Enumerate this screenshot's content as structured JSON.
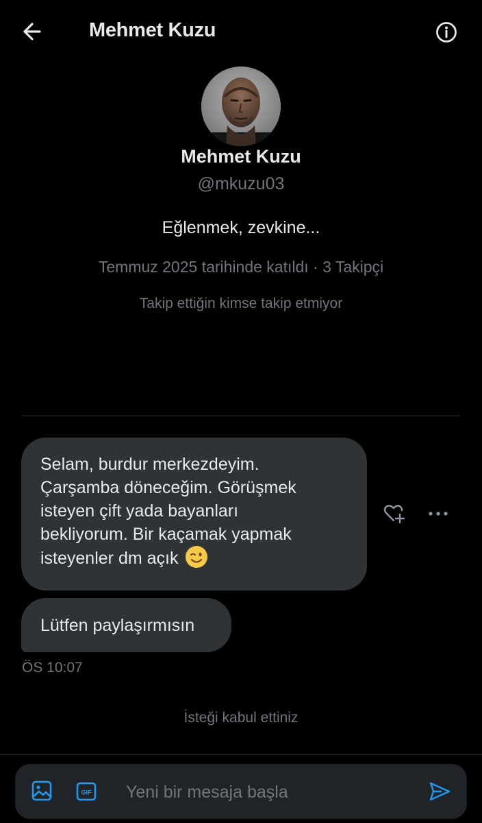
{
  "header": {
    "title": "Mehmet Kuzu"
  },
  "profile": {
    "name": "Mehmet Kuzu",
    "handle": "@mkuzu03",
    "bio": "Eğlenmek, zevkine...",
    "meta": "Temmuz 2025 tarihinde katıldı · 3 Takipçi",
    "follow_note": "Takip ettiğin kimse takip etmiyor"
  },
  "messages": [
    {
      "lines": [
        "Selam, burdur merkezdeyim.",
        "Çarşamba döneceğim. Görüşmek",
        "isteyen çift yada bayanları",
        "bekliyorum. Bir kaçamak yapmak",
        "isteyenler dm açık"
      ],
      "emoji": "winking-face"
    },
    {
      "text": "Lütfen paylaşırmısın"
    }
  ],
  "timestamp": "ÖS 10:07",
  "status_text": "İsteği kabul ettiniz",
  "composer": {
    "placeholder": "Yeni bir mesaja başla",
    "gif_label": "GIF"
  },
  "colors": {
    "background": "#000000",
    "bubble": "#2f3336",
    "text": "#e7e9ea",
    "muted": "#71767b",
    "accent": "#1d9bf0",
    "composer_bg": "#202327"
  },
  "icons": [
    "back-arrow-icon",
    "info-icon",
    "heart-plus-icon",
    "more-icon",
    "image-icon",
    "gif-icon",
    "send-icon"
  ]
}
